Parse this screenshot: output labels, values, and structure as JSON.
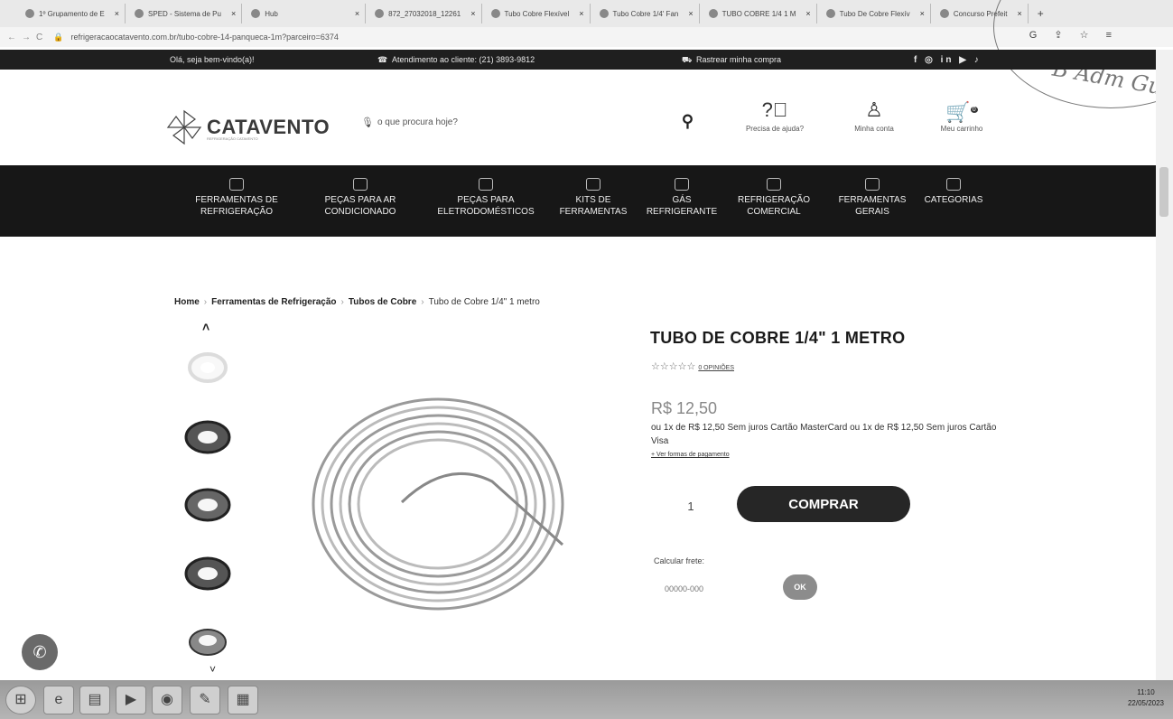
{
  "browser": {
    "tabs": [
      "1º Grupamento de E",
      "SPED - Sistema de Pu",
      "Hub",
      "872_27032018_12261",
      "Tubo Cobre Flexível",
      "Tubo Cobre 1/4' Fan",
      "TUBO COBRE 1/4 1 M",
      "Tubo De Cobre Flexív",
      "Concurso Prefeit"
    ],
    "url": "refrigeracaocatavento.com.br/tubo-cobre-14-panqueca-1m?parceiro=6374"
  },
  "infobar": {
    "greeting": "Olá, seja bem-vindo(a)!",
    "service": "Atendimento ao cliente: (21) 3893-9812",
    "track": "Rastrear minha compra",
    "social": "f ◎ in ▶ ♪"
  },
  "header": {
    "brand": "CATAVENTO",
    "tagline": "REFRIGERAÇÃO CATAVENTO",
    "search_placeholder": "o que procura hoje?",
    "help_label": "Precisa de ajuda?",
    "account_label": "Minha conta",
    "cart_label": "Meu carrinho",
    "cart_count": "0"
  },
  "nav": [
    "FERRAMENTAS DE\nREFRIGERAÇÃO",
    "PEÇAS PARA AR\nCONDICIONADO",
    "PEÇAS PARA\nELETRODOMÉSTICOS",
    "KITS DE\nFERRAMENTAS",
    "GÁS\nREFRIGERANTE",
    "REFRIGERAÇÃO\nCOMERCIAL",
    "FERRAMENTAS\nGERAIS",
    "CATEGORIAS"
  ],
  "breadcrumb": {
    "home": "Home",
    "level1": "Ferramentas de Refrigeração",
    "level2": "Tubos de Cobre",
    "current": "Tubo de Cobre 1/4\" 1 metro"
  },
  "product": {
    "title": "TUBO DE COBRE 1/4\" 1 METRO",
    "stars": "☆☆☆☆☆",
    "reviews": "0 OPINIÕES",
    "price": "R$ 12,50",
    "installments": "ou 1x de R$ 12,50 Sem juros Cartão MasterCard ou 1x de R$ 12,50 Sem juros Cartão Visa",
    "payment_link": "+ Ver formas de pagamento",
    "quantity": "1",
    "buy_label": "COMPRAR",
    "freight_label": "Calcular frete:",
    "cep_placeholder": "00000-000",
    "ok_label": "OK"
  },
  "stamp_text": "B Adm Gu",
  "taskbar": {
    "time": "11:10",
    "date": "22/05/2023"
  }
}
